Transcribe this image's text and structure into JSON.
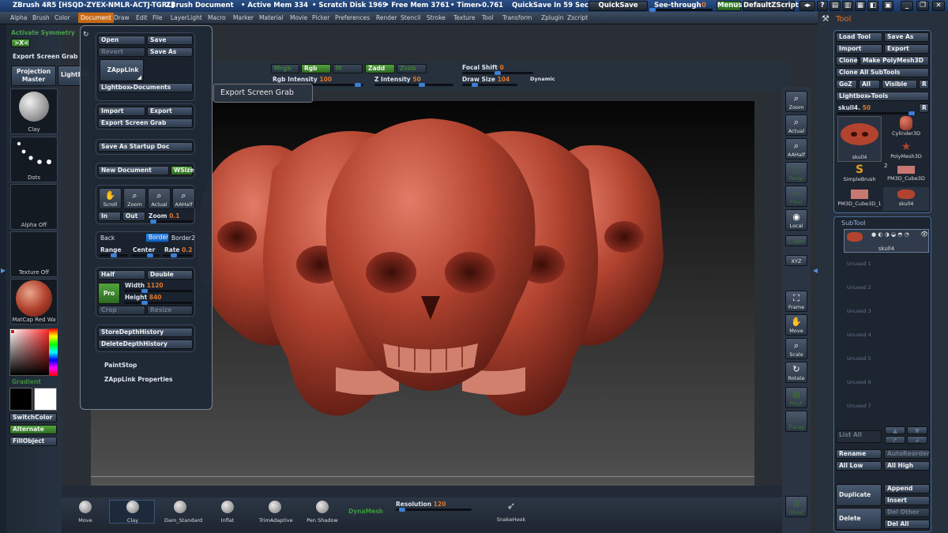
{
  "titlebar": {
    "app": "ZBrush 4R5 [HSQD-ZYEX-NMLR-ACTJ-TGRL]",
    "document": "ZBrush Document",
    "active_mem": "• Active Mem 334",
    "scratch_disk": "• Scratch Disk 1969",
    "free_mem": "• Free Mem 3761",
    "timer": "• Timer▸0.761",
    "quicksave_timer": "QuickSave In 59 Secs",
    "quicksave": "QuickSave",
    "see_through": "See-through",
    "see_through_value": "0",
    "menus": "Menus",
    "default_zscript": "DefaultZScript"
  },
  "menubar": [
    "Alpha",
    "Brush",
    "Color",
    "Document",
    "Draw",
    "Edit",
    "File",
    "Layer",
    "Light",
    "Macro",
    "Marker",
    "Material",
    "Movie",
    "Picker",
    "Preferences",
    "Render",
    "Stencil",
    "Stroke",
    "Texture",
    "Tool",
    "Transform",
    "Zplugin",
    "Zscript"
  ],
  "left": {
    "activate_symmetry": "Activate Symmetry",
    "xyz": ">X<",
    "export_screen_grab": "Export Screen Grab",
    "projection_master": "Projection Master",
    "lightbox": "LightBox",
    "clay": "Clay",
    "dots": "Dots",
    "alpha_off": "Alpha Off",
    "texture_off": "Texture Off",
    "matcap": "MatCap Red Wa",
    "gradient": "Gradient",
    "switch_color": "SwitchColor",
    "alternate": "Alternate",
    "fill_object": "FillObject"
  },
  "doc": {
    "open": "Open",
    "save": "Save",
    "revert": "Revert",
    "save_as": "Save As",
    "zapplink": "ZAppLink",
    "lightbox_documents": "Lightbox▸Documents",
    "import": "Import",
    "export": "Export",
    "export_screen_grab": "Export Screen Grab",
    "save_startup": "Save As Startup Doc",
    "new_document": "New Document",
    "wsize": "WSize",
    "scroll": "Scroll",
    "zoom": "Zoom",
    "actual": "Actual",
    "aahalf": "AAHalf",
    "in": "In",
    "out": "Out",
    "zoom_label": "Zoom",
    "zoom_value": "0.1",
    "back": "Back",
    "border": "Border",
    "border2": "Border2",
    "range": "Range",
    "center": "Center",
    "rate": "Rate",
    "rate_value": "0.2",
    "half": "Half",
    "double": "Double",
    "pro": "Pro",
    "width": "Width",
    "width_value": "1120",
    "height": "Height",
    "height_value": "840",
    "crop": "Crop",
    "resize": "Resize",
    "store_depth": "StoreDepthHistory",
    "delete_depth": "DeleteDepthHistory",
    "paint_stop": "PaintStop",
    "zapplink_props": "ZAppLink Properties"
  },
  "tooltip": "Export Screen Grab",
  "topstrip": {
    "mrgb": "Mrgb",
    "rgb": "Rgb",
    "m": "M",
    "zadd": "Zadd",
    "zsub": "Zsub",
    "rgb_intensity": "Rgb Intensity",
    "rgb_intensity_value": "100",
    "z_intensity": "Z Intensity",
    "z_intensity_value": "50",
    "focal_shift": "Focal Shift",
    "focal_shift_value": "0",
    "draw_size": "Draw Size",
    "draw_size_value": "104",
    "dynamic": "Dynamic"
  },
  "rightbar": [
    {
      "name": "zoom",
      "cap": "Zoom",
      "on": true
    },
    {
      "name": "actual",
      "cap": "Actual",
      "on": true
    },
    {
      "name": "aahalf",
      "cap": "AAHalf",
      "on": true
    },
    {
      "name": "persp",
      "cap": "Persp",
      "on": false
    },
    {
      "name": "floor",
      "cap": "Floor",
      "on": false
    },
    {
      "name": "local",
      "cap": "Local",
      "on": true
    },
    {
      "name": "lsym",
      "cap": "L.Sym",
      "on": false
    },
    {
      "name": "xyz",
      "cap": "XYZ",
      "on": true
    },
    {
      "name": "frame",
      "cap": "Frame",
      "on": true
    },
    {
      "name": "move",
      "cap": "Move",
      "on": true
    },
    {
      "name": "scale",
      "cap": "Scale",
      "on": true
    },
    {
      "name": "rotate",
      "cap": "Rotate",
      "on": true
    },
    {
      "name": "polyf",
      "cap": "PolyF",
      "on": false
    },
    {
      "name": "transp",
      "cap": "Transp",
      "on": false
    },
    {
      "name": "ghost",
      "cap": "Ghost",
      "on": false
    }
  ],
  "tool": {
    "title": "Tool",
    "load_tool": "Load Tool",
    "save_as": "Save As",
    "import": "Import",
    "export": "Export",
    "clone": "Clone",
    "make_polymesh": "Make PolyMesh3D",
    "clone_all": "Clone All SubTools",
    "goz": "GoZ",
    "all": "All",
    "visible": "Visible",
    "r": "R",
    "lightbox_tools": "Lightbox▸Tools",
    "current": "skull4.",
    "current_value": "50",
    "thumbs": [
      "skull4",
      "Cylinder3D",
      "PolyMesh3D",
      "SimpleBrush",
      "PM3D_Cube3D",
      "PM3D_Cube3D_1",
      "skull4"
    ],
    "thumb_count": "2"
  },
  "subtool": {
    "title": "SubTool",
    "active": "skull4",
    "unused": [
      "Unused 1",
      "Unused 2",
      "Unused 3",
      "Unused 4",
      "Unused 5",
      "Unused 6",
      "Unused 7"
    ],
    "list_all": "List All",
    "rename": "Rename",
    "auto_reorder": "AutoReorder",
    "all_low": "All Low",
    "all_high": "All High",
    "append": "Append",
    "duplicate": "Duplicate",
    "insert": "Insert",
    "del_other": "Del Other",
    "delete": "Delete",
    "del_all": "Del All"
  },
  "bottom": {
    "brushes": [
      "Move",
      "Clay",
      "Dam_Standard",
      "Inflat",
      "TrimAdaptive",
      "Pen Shadow"
    ],
    "dynamesh": "DynaMesh",
    "resolution": "Resolution",
    "resolution_value": "120",
    "snakehook": "SnakeHook"
  },
  "colors": {
    "accent_orange": "#c76815",
    "skull": "#b14437",
    "green": "#3e8a30",
    "blue": "#1e70d3"
  }
}
